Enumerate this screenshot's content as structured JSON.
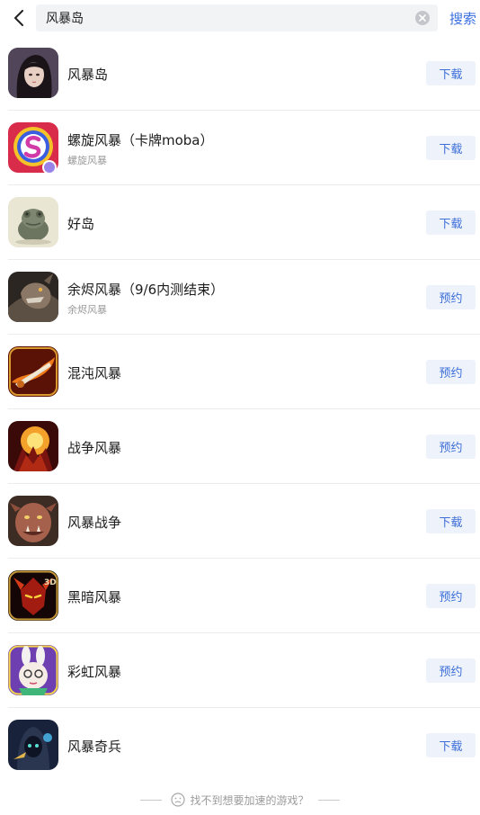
{
  "search": {
    "query": "风暴岛",
    "submit_label": "搜索"
  },
  "results": [
    {
      "name": "风暴岛",
      "subname": "",
      "action": "下载",
      "icon": "dark-haired-girl-icon"
    },
    {
      "name": "螺旋风暴（卡牌moba）",
      "subname": "螺旋风暴",
      "action": "下载",
      "icon": "spiral-s-logo-icon"
    },
    {
      "name": "好岛",
      "subname": "",
      "action": "下载",
      "icon": "frog-statue-icon"
    },
    {
      "name": "余烬风暴（9/6内测结束）",
      "subname": "余烬风暴",
      "action": "预约",
      "icon": "dragon-warrior-icon"
    },
    {
      "name": "混沌风暴",
      "subname": "",
      "action": "预约",
      "icon": "flaming-sword-icon"
    },
    {
      "name": "战争风暴",
      "subname": "",
      "action": "预约",
      "icon": "fire-demon-icon"
    },
    {
      "name": "风暴战争",
      "subname": "",
      "action": "下载",
      "icon": "orc-face-icon"
    },
    {
      "name": "黑暗风暴",
      "subname": "",
      "action": "预约",
      "icon": "red-demon-3d-icon"
    },
    {
      "name": "彩虹风暴",
      "subname": "",
      "action": "预约",
      "icon": "bunny-girl-icon"
    },
    {
      "name": "风暴奇兵",
      "subname": "",
      "action": "下载",
      "icon": "hooded-warrior-icon"
    }
  ],
  "footer": {
    "hint": "找不到想要加速的游戏？"
  },
  "colors": {
    "accent": "#3d6ed8",
    "button_bg": "#eef3fb",
    "search_bg": "#f2f3f5"
  }
}
